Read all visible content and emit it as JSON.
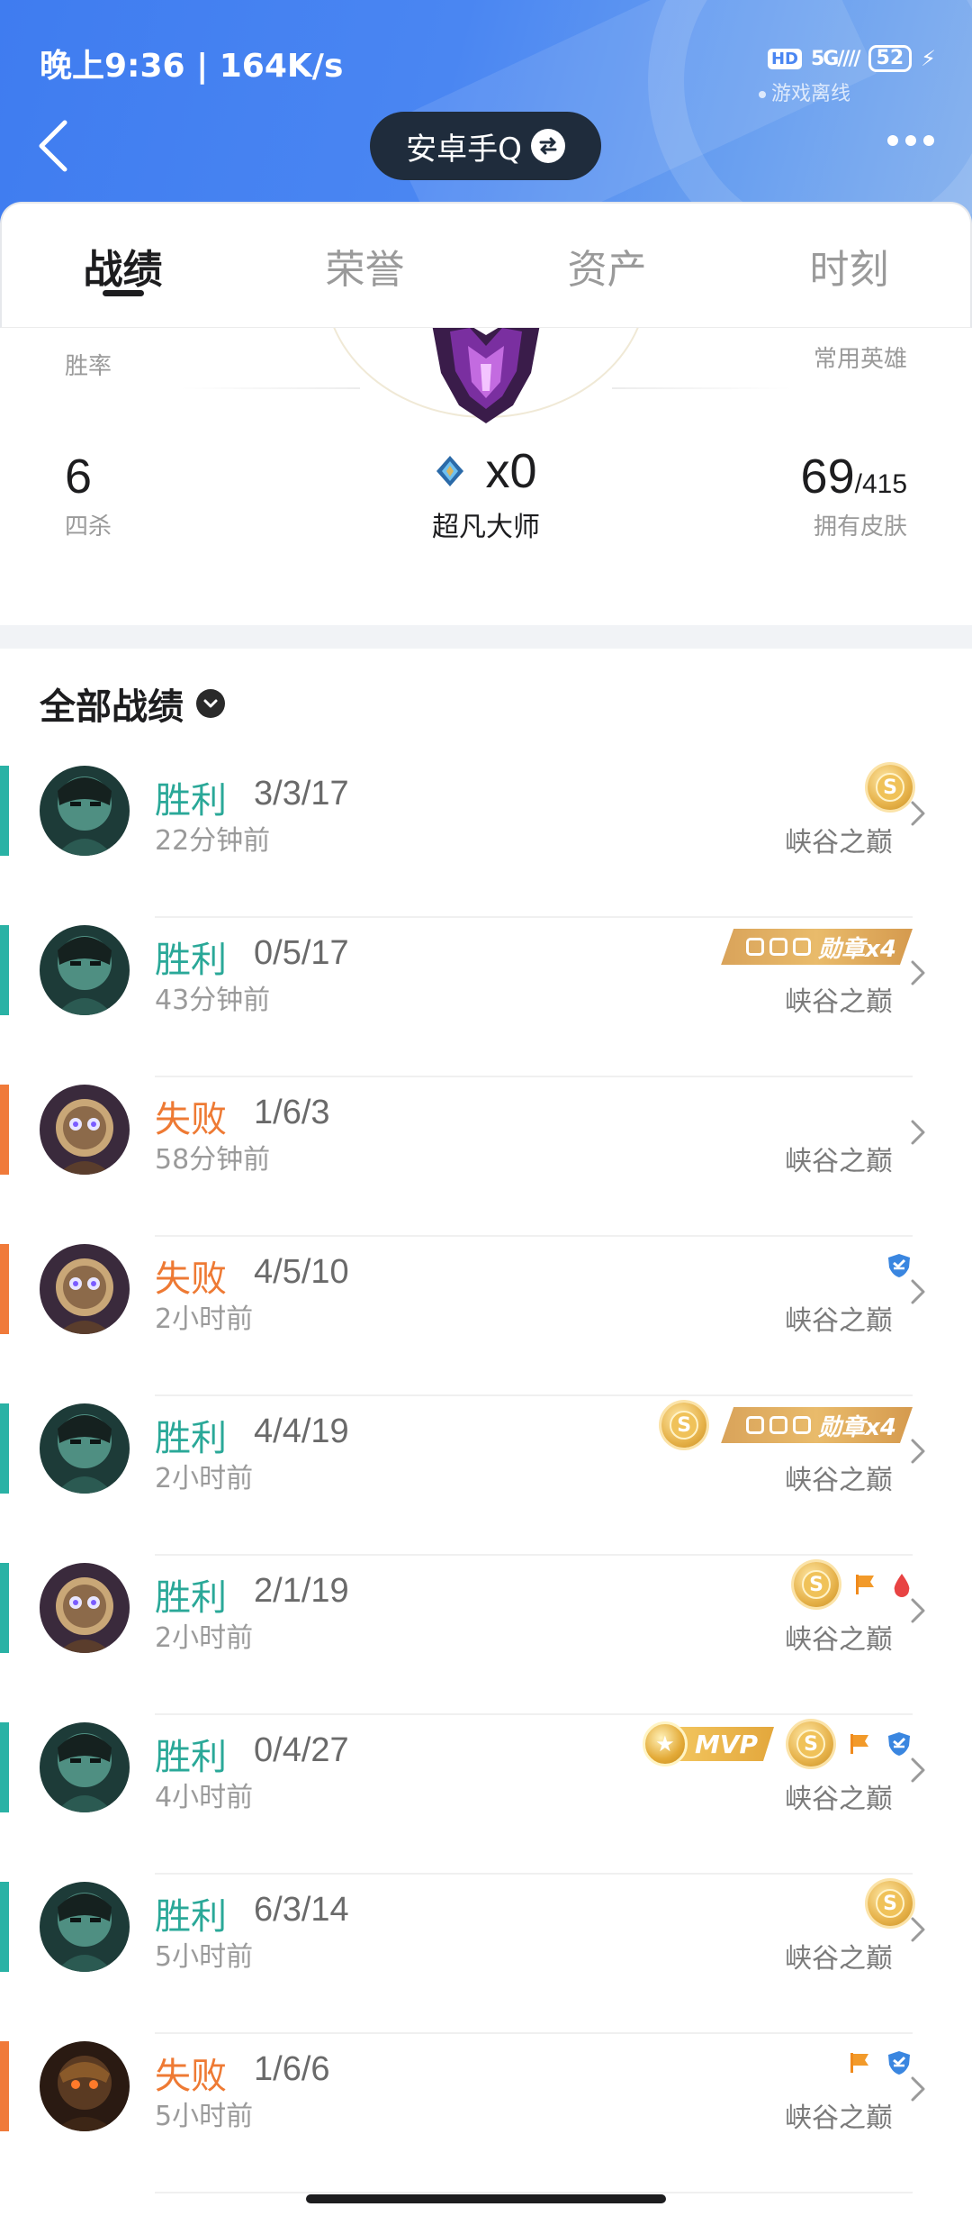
{
  "status_bar": {
    "time_speed": "晚上9:36 | 164K/s",
    "hd": "HD",
    "network": "5G",
    "battery": "52",
    "offline_text": "游戏离线"
  },
  "header": {
    "account_name": "安卓手Q",
    "icons": {
      "back": "back-arrow-icon",
      "switch": "switch-account-icon",
      "more": "more-dots-icon"
    }
  },
  "tabs": [
    {
      "label": "战绩",
      "active": true
    },
    {
      "label": "荣誉",
      "active": false
    },
    {
      "label": "资产",
      "active": false
    },
    {
      "label": "时刻",
      "active": false
    }
  ],
  "summary": {
    "winrate_label": "胜率",
    "favorite_hero_label": "常用英雄",
    "quadra_kills": {
      "value": "6",
      "label": "四杀"
    },
    "rank": {
      "value": "x0",
      "label": "超凡大师"
    },
    "skins": {
      "owned": "69",
      "total": "/415",
      "label": "拥有皮肤"
    }
  },
  "section": {
    "title": "全部战绩"
  },
  "matches": [
    {
      "result": "胜利",
      "outcome": "win",
      "kda": "3/3/17",
      "time": "22分钟前",
      "mode": "峡谷之巅",
      "avatar": "dark-hero",
      "badges": [
        "coin"
      ]
    },
    {
      "result": "胜利",
      "outcome": "win",
      "kda": "0/5/17",
      "time": "43分钟前",
      "mode": "峡谷之巅",
      "avatar": "dark-hero",
      "badges": [
        "medal"
      ],
      "medal_text": "勋章x4"
    },
    {
      "result": "失败",
      "outcome": "loss",
      "kda": "1/6/3",
      "time": "58分钟前",
      "mode": "峡谷之巅",
      "avatar": "robot-hero",
      "badges": []
    },
    {
      "result": "失败",
      "outcome": "loss",
      "kda": "4/5/10",
      "time": "2小时前",
      "mode": "峡谷之巅",
      "avatar": "robot-hero",
      "badges": [
        "shield"
      ]
    },
    {
      "result": "胜利",
      "outcome": "win",
      "kda": "4/4/19",
      "time": "2小时前",
      "mode": "峡谷之巅",
      "avatar": "dark-hero",
      "badges": [
        "coin",
        "medal"
      ],
      "medal_text": "勋章x4"
    },
    {
      "result": "胜利",
      "outcome": "win",
      "kda": "2/1/19",
      "time": "2小时前",
      "mode": "峡谷之巅",
      "avatar": "robot-hero",
      "badges": [
        "coin",
        "flag",
        "blood"
      ]
    },
    {
      "result": "胜利",
      "outcome": "win",
      "kda": "0/4/27",
      "time": "4小时前",
      "mode": "峡谷之巅",
      "avatar": "dark-hero",
      "badges": [
        "mvp",
        "coin",
        "flag",
        "shield"
      ],
      "mvp_text": "MVP"
    },
    {
      "result": "胜利",
      "outcome": "win",
      "kda": "6/3/14",
      "time": "5小时前",
      "mode": "峡谷之巅",
      "avatar": "dark-hero",
      "badges": [
        "coin"
      ]
    },
    {
      "result": "失败",
      "outcome": "loss",
      "kda": "1/6/6",
      "time": "5小时前",
      "mode": "峡谷之巅",
      "avatar": "warrior-hero",
      "badges": [
        "flag",
        "shield"
      ]
    }
  ],
  "colors": {
    "header": "#4a86f2",
    "win": "#2ab2a5",
    "loss": "#f07a3a",
    "coin": "#e6b24a"
  }
}
